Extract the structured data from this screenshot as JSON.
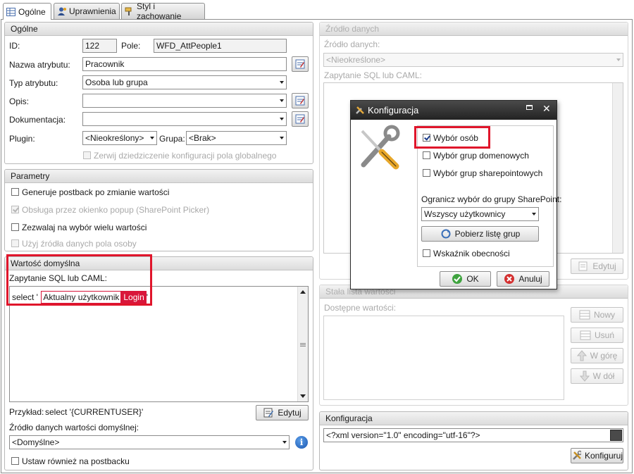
{
  "tabs": [
    {
      "label": "Ogólne",
      "icon": "table-icon"
    },
    {
      "label": "Uprawnienia",
      "icon": "user-icon"
    },
    {
      "label": "Styl i zachowanie",
      "icon": "paint-icon"
    }
  ],
  "general": {
    "title": "Ogólne",
    "id_label": "ID:",
    "id_value": "122",
    "field_label": "Pole:",
    "field_value": "WFD_AttPeople1",
    "name_label": "Nazwa atrybutu:",
    "name_value": "Pracownik",
    "type_label": "Typ atrybutu:",
    "type_value": "Osoba lub grupa",
    "desc_label": "Opis:",
    "desc_value": "",
    "doc_label": "Dokumentacja:",
    "doc_value": "",
    "plugin_label": "Plugin:",
    "plugin_value": "<Nieokreślony>",
    "group_label": "Grupa:",
    "group_value": "<Brak>",
    "inherit_label": "Zerwij dziedziczenie konfiguracji pola globalnego"
  },
  "params": {
    "title": "Parametry",
    "opt1": "Generuje postback po zmianie wartości",
    "opt2": "Obsługa przez okienko popup (SharePoint Picker)",
    "opt3": "Zezwalaj na wybór wielu wartości",
    "opt4": "Użyj źródła danych pola osoby"
  },
  "default": {
    "title": "Wartość domyślna",
    "query_label": "Zapytanie SQL lub CAML:",
    "query_prefix": "select '",
    "token1": "Aktualny użytkownik",
    "token2": "Login",
    "query_suffix": "'",
    "example_label": "Przykład:",
    "example_value": "select '{CURRENTUSER}'",
    "edit_label": "Edytuj",
    "source_label": "Źródło danych wartości domyślnej:",
    "source_value": "<Domyślne>",
    "postback_label": "Ustaw również na postbacku"
  },
  "datasource": {
    "title": "Źródło danych",
    "source_label": "Źródło danych:",
    "source_value": "<Nieokreślone>",
    "query_label": "Zapytanie SQL lub CAML:",
    "edit_label": "Edytuj"
  },
  "fixed": {
    "title": "Stała lista wartości",
    "values_label": "Dostępne wartości:",
    "new_label": "Nowy",
    "delete_label": "Usuń",
    "up_label": "W górę",
    "down_label": "W dół"
  },
  "config": {
    "title": "Konfiguracja",
    "xml": "<?xml version=\"1.0\" encoding=\"utf-16\"?>",
    "button_label": "Konfiguruj"
  },
  "dialog": {
    "title": "Konfiguracja",
    "opt_persons": "Wybór osób",
    "opt_domain": "Wybór grup domenowych",
    "opt_sp": "Wybór grup sharepointowych",
    "limit_label": "Ogranicz wybór do grupy SharePoint:",
    "limit_value": "Wszyscy użytkownicy",
    "fetch_label": "Pobierz listę grup",
    "presence_label": "Wskaźnik obecności",
    "ok_label": "OK",
    "cancel_label": "Anuluj"
  }
}
